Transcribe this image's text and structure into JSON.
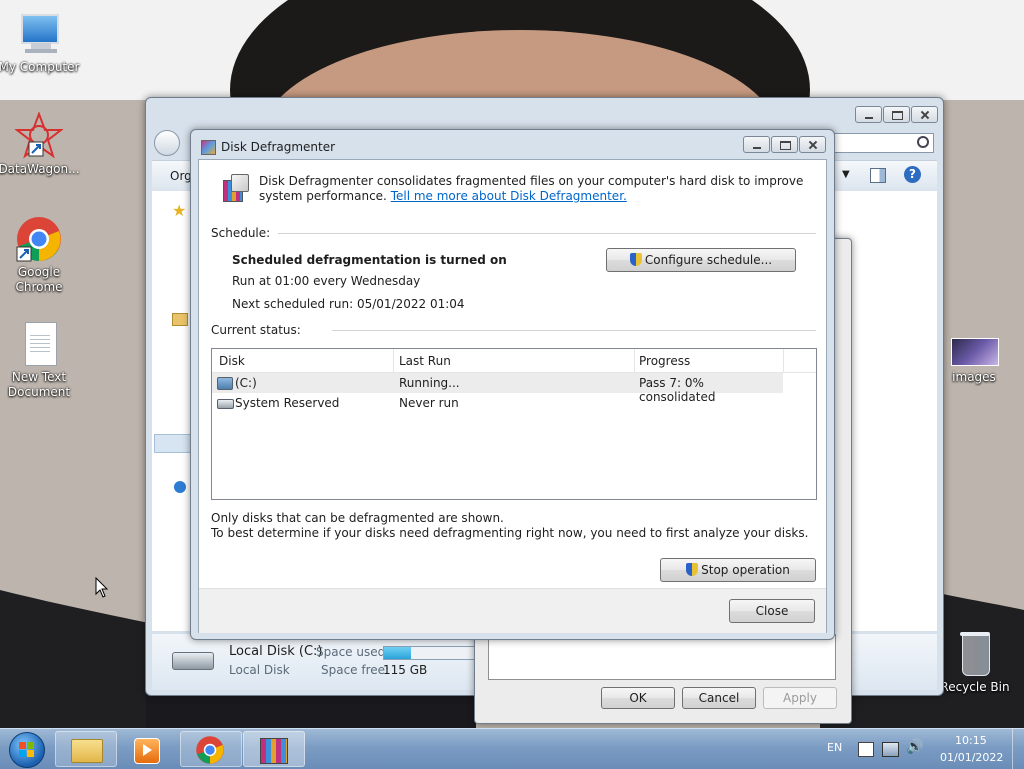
{
  "desktop": {
    "icons": [
      {
        "label": "My Computer",
        "icon": "computer-icon"
      },
      {
        "label": "DataWagon...",
        "icon": "datawagon-icon"
      },
      {
        "label": "Google Chrome",
        "icon": "chrome-icon"
      },
      {
        "label": "New Text Document",
        "icon": "text-document-icon"
      },
      {
        "label": "images",
        "icon": "image-file-icon"
      },
      {
        "label": "Recycle Bin",
        "icon": "recycle-bin-icon"
      }
    ]
  },
  "explorer": {
    "toolbar_label": "Org",
    "drive": {
      "name": "Local Disk (C:)",
      "type": "Local Disk",
      "space_used_label": "Space used:",
      "space_free_label": "Space free:",
      "space_free": "115 GB",
      "used_fraction": 0.19
    }
  },
  "properties_dialog": {
    "ok": "OK",
    "cancel": "Cancel",
    "apply": "Apply"
  },
  "defrag": {
    "title": "Disk Defragmenter",
    "intro": "Disk Defragmenter consolidates fragmented files on your computer's hard disk to improve system performance.",
    "link": "Tell me more about Disk Defragmenter.",
    "schedule_label": "Schedule:",
    "schedule_status": "Scheduled defragmentation is turned on",
    "run_at": "Run at 01:00 every Wednesday",
    "next_run": "Next scheduled run: 05/01/2022 01:04",
    "configure_button": "Configure schedule...",
    "current_status_label": "Current status:",
    "columns": [
      "Disk",
      "Last Run",
      "Progress"
    ],
    "rows": [
      {
        "disk": "(C:)",
        "last_run": "Running...",
        "progress": "Pass 7: 0% consolidated"
      },
      {
        "disk": "System Reserved",
        "last_run": "Never run",
        "progress": ""
      }
    ],
    "note1": "Only disks that can be defragmented are shown.",
    "note2": "To best determine if your disks need defragmenting right now, you need to first analyze your disks.",
    "stop_button": "Stop operation",
    "close_button": "Close"
  },
  "taskbar": {
    "language": "EN",
    "time": "10:15",
    "date": "01/01/2022",
    "items": [
      "windows-explorer",
      "media-player",
      "google-chrome",
      "disk-defragmenter"
    ]
  },
  "colors": {
    "link": "#0066cc",
    "selection": "#ececec",
    "usage_bar": "#2aa3d8"
  }
}
